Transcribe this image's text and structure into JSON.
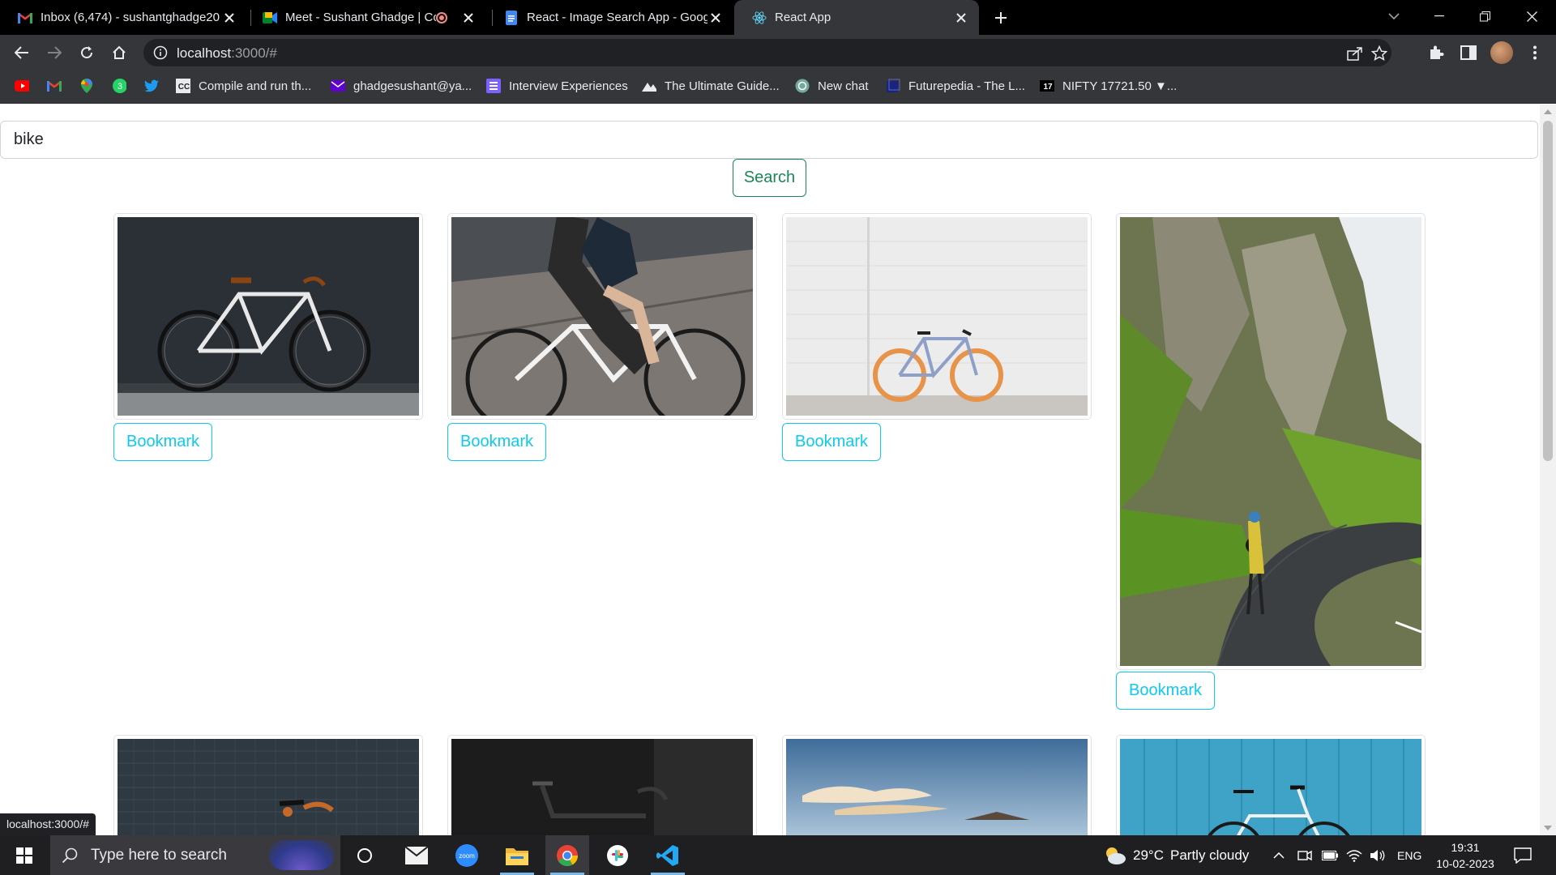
{
  "browser": {
    "tabs": [
      {
        "title": "Inbox (6,474) - sushantghadge20",
        "favicon": "gmail-icon"
      },
      {
        "title": "Meet - Sushant Ghadge | Co",
        "favicon": "meet-icon"
      },
      {
        "title": "React - Image Search App - Goog",
        "favicon": "docs-icon"
      },
      {
        "title": "React App",
        "favicon": "react-icon",
        "active": true
      }
    ],
    "url": {
      "host": "localhost",
      "rest": ":3000/#"
    },
    "bookmarks": [
      {
        "label": "",
        "icon": "youtube-icon"
      },
      {
        "label": "",
        "icon": "gmail-icon"
      },
      {
        "label": "",
        "icon": "maps-icon"
      },
      {
        "label": "",
        "icon": "whatsapp-icon"
      },
      {
        "label": "",
        "icon": "twitter-icon"
      },
      {
        "label": "Compile and run th...",
        "icon": "cc-icon"
      },
      {
        "label": "ghadgesushant@ya...",
        "icon": "yahoo-mail-icon"
      },
      {
        "label": "Interview Experiences",
        "icon": "list-icon"
      },
      {
        "label": "The Ultimate Guide...",
        "icon": "mountain-icon"
      },
      {
        "label": "New chat",
        "icon": "openai-icon"
      },
      {
        "label": "Futurepedia - The L...",
        "icon": "futurepedia-icon"
      },
      {
        "label": "NIFTY 17721.50 ▼...",
        "icon": "tradingview-icon"
      }
    ],
    "status_url": "localhost:3000/#"
  },
  "app": {
    "search": {
      "value": "bike",
      "button_label": "Search"
    },
    "bookmark_label": "Bookmark",
    "images": [
      {
        "subject": "fixie bike against dark wall"
      },
      {
        "subject": "rider on white road bike"
      },
      {
        "subject": "bike with orange tires at white brick wall"
      },
      {
        "subject": "cyclist on green mountain road"
      },
      {
        "subject": "bike at tiled wall"
      },
      {
        "subject": "black road bike dark background"
      },
      {
        "subject": "sunset sky"
      },
      {
        "subject": "white bike at blue wall"
      }
    ]
  },
  "taskbar": {
    "search_placeholder": "Type here to search",
    "weather": {
      "temp": "29°C",
      "condition": "Partly cloudy"
    },
    "language": "ENG",
    "time": "19:31",
    "date": "10-02-2023"
  }
}
